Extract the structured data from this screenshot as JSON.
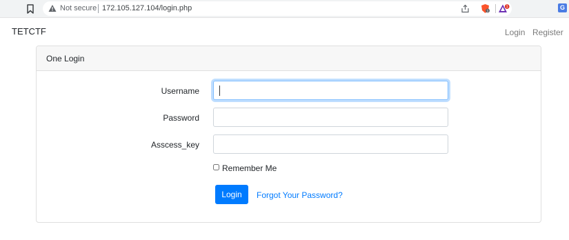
{
  "browser": {
    "security_label": "Not secure",
    "url": "172.105.127.104/login.php",
    "brave_badge": "1",
    "rewards_badge": "1",
    "translate_glyph": "G"
  },
  "navbar": {
    "brand": "TETCTF",
    "login": "Login",
    "register": "Register"
  },
  "card": {
    "title": "One Login",
    "fields": {
      "username": {
        "label": "Username",
        "value": ""
      },
      "password": {
        "label": "Password",
        "value": ""
      },
      "access_key": {
        "label": "Asscess_key",
        "value": ""
      }
    },
    "remember_label": "Remember Me",
    "remember_checked": false,
    "login_button": "Login",
    "forgot_link": "Forgot Your Password?"
  },
  "colors": {
    "primary": "#007bff",
    "focus_border": "#80bdff",
    "header_bg": "#f7f7f7",
    "chrome_bg": "#f1f3f4"
  }
}
